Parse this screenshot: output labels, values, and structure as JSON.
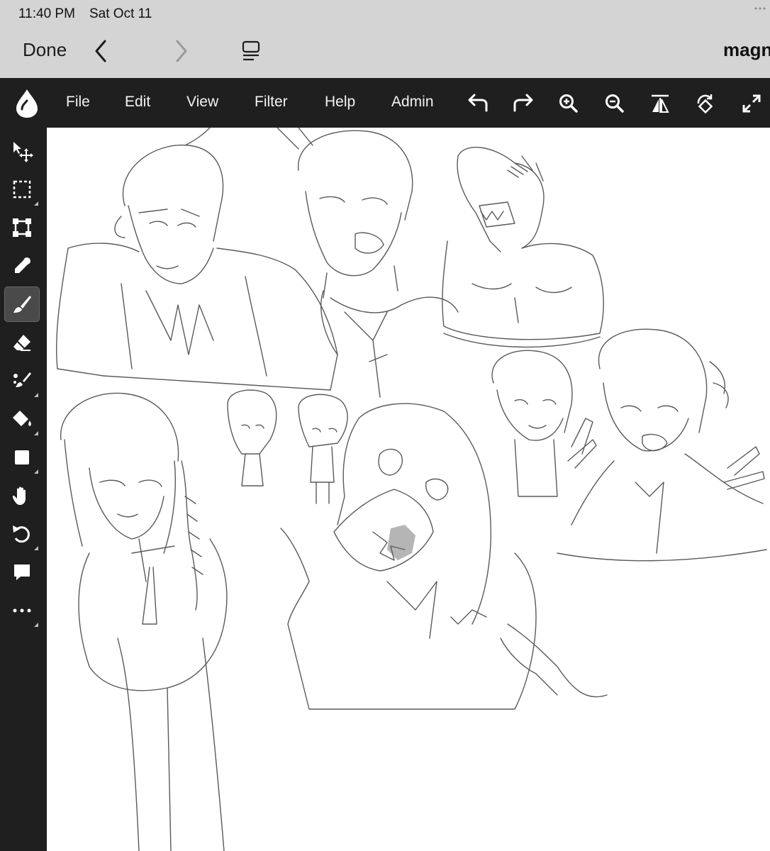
{
  "status_bar": {
    "time": "11:40 PM",
    "date": "Sat Oct 11"
  },
  "browser_bar": {
    "done_label": "Done",
    "site_title": "magn"
  },
  "app_bar": {
    "menu": [
      "File",
      "Edit",
      "View",
      "Filter",
      "Help",
      "Admin"
    ],
    "tools": [
      "undo-icon",
      "redo-icon",
      "zoom-in-icon",
      "zoom-out-icon",
      "flip-horizontal-icon",
      "rotate-icon",
      "fullscreen-icon"
    ]
  },
  "left_toolbar": {
    "tools": [
      "move-icon",
      "select-icon",
      "transform-icon",
      "eyedropper-icon",
      "brush-icon",
      "eraser-icon",
      "blend-icon",
      "fill-icon",
      "shape-icon",
      "hand-icon",
      "rotate-view-icon",
      "comment-icon",
      "more-icon"
    ],
    "active_tool": "brush-icon"
  },
  "canvas": {
    "content": "grayscale pencil sketch of anime-style characters",
    "line_color": "#5a5a5a",
    "background": "#ffffff"
  }
}
